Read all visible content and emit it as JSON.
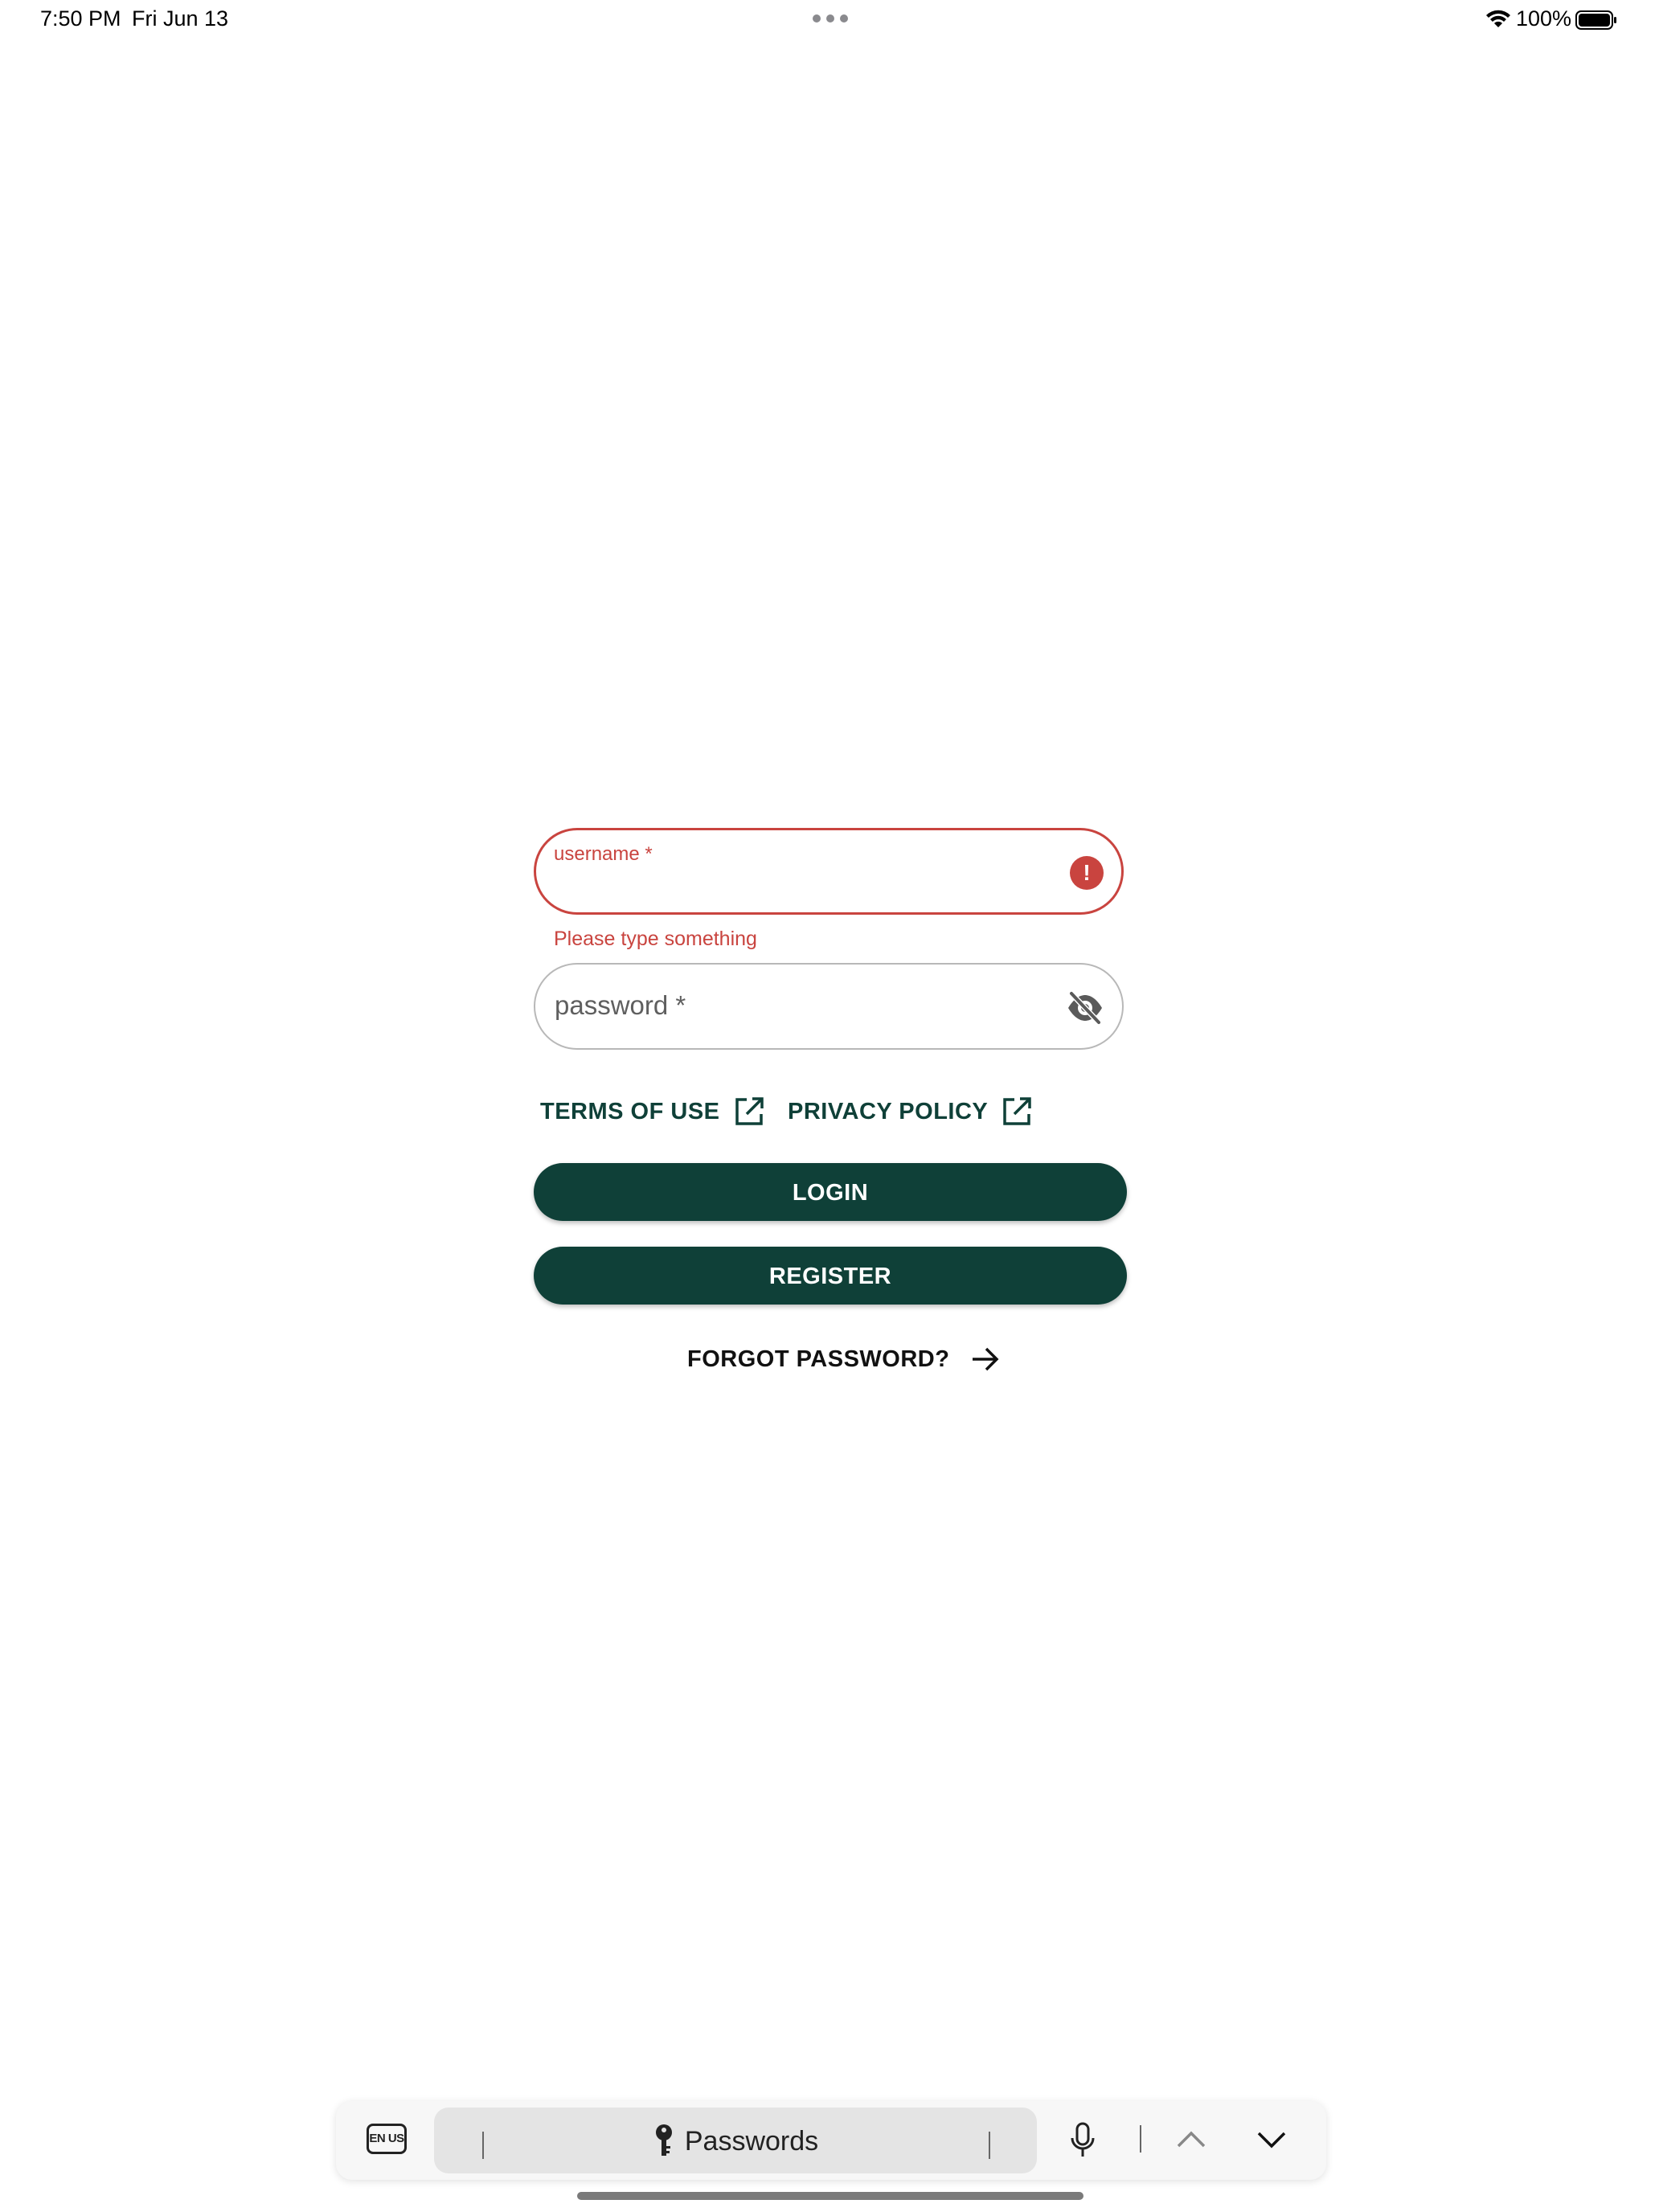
{
  "status_bar": {
    "time": "7:50 PM",
    "date": "Fri Jun 13",
    "battery_percent": "100%",
    "wifi_icon": "wifi-icon",
    "battery_icon": "battery-full-icon"
  },
  "login_form": {
    "username": {
      "label": "username *",
      "value": "",
      "error": "Please type something",
      "error_icon": "error-circle-icon"
    },
    "password": {
      "placeholder": "password *",
      "value": "",
      "visibility_icon": "eye-off-icon"
    },
    "links": {
      "terms_label": "TERMS OF USE",
      "privacy_label": "PRIVACY POLICY",
      "external_icon": "open-in-new-icon"
    },
    "login_label": "LOGIN",
    "register_label": "REGISTER",
    "forgot_label": "FORGOT PASSWORD?",
    "forgot_icon": "arrow-right-icon"
  },
  "keyboard_bar": {
    "language_badge": "EN US",
    "passwords_label": "Passwords",
    "icons": [
      "key-icon",
      "microphone-icon",
      "chevron-up-icon",
      "chevron-down-icon"
    ]
  },
  "colors": {
    "brand_dark_green": "#0f4038",
    "error_red": "#c9443f",
    "border_gray": "#b8b8b8"
  }
}
